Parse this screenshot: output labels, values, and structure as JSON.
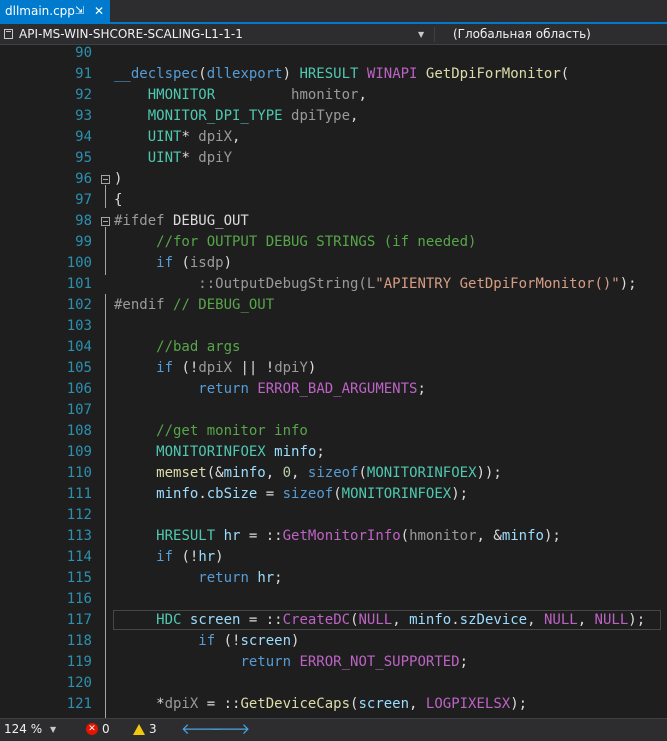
{
  "tab": {
    "title": "dllmain.cpp",
    "pin_icon": "⇲",
    "close_icon": "✕"
  },
  "navbar": {
    "scope_dropdown": "API-MS-WIN-SHCORE-SCALING-L1-1-1",
    "member_dropdown": "(Глобальная область)"
  },
  "editor": {
    "line_numbers": [
      "90",
      "91",
      "92",
      "93",
      "94",
      "95",
      "96",
      "97",
      "98",
      "99",
      "100",
      "101",
      "102",
      "103",
      "104",
      "105",
      "106",
      "107",
      "108",
      "109",
      "110",
      "111",
      "112",
      "113",
      "114",
      "115",
      "116",
      "117",
      "118",
      "119",
      "120",
      "121"
    ],
    "lines": [
      [],
      [
        {
          "t": "__declspec",
          "c": "kw"
        },
        {
          "t": "(",
          "c": ""
        },
        {
          "t": "dllexport",
          "c": "kw"
        },
        {
          "t": ") ",
          "c": ""
        },
        {
          "t": "HRESULT",
          "c": "ty"
        },
        {
          "t": " ",
          "c": ""
        },
        {
          "t": "WINAPI",
          "c": "mac"
        },
        {
          "t": " ",
          "c": ""
        },
        {
          "t": "GetDpiForMonitor",
          "c": "fn"
        },
        {
          "t": "(",
          "c": ""
        }
      ],
      [
        {
          "t": "    ",
          "c": ""
        },
        {
          "t": "HMONITOR",
          "c": "ty"
        },
        {
          "t": "         ",
          "c": ""
        },
        {
          "t": "hmonitor",
          "c": "pa"
        },
        {
          "t": ",",
          "c": ""
        }
      ],
      [
        {
          "t": "    ",
          "c": ""
        },
        {
          "t": "MONITOR_DPI_TYPE",
          "c": "ty"
        },
        {
          "t": " ",
          "c": ""
        },
        {
          "t": "dpiType",
          "c": "pa"
        },
        {
          "t": ",",
          "c": ""
        }
      ],
      [
        {
          "t": "    ",
          "c": ""
        },
        {
          "t": "UINT",
          "c": "ty"
        },
        {
          "t": "* ",
          "c": ""
        },
        {
          "t": "dpiX",
          "c": "pa"
        },
        {
          "t": ",",
          "c": ""
        }
      ],
      [
        {
          "t": "    ",
          "c": ""
        },
        {
          "t": "UINT",
          "c": "ty"
        },
        {
          "t": "* ",
          "c": ""
        },
        {
          "t": "dpiY",
          "c": "pa"
        }
      ],
      [
        {
          "t": ")",
          "c": ""
        }
      ],
      [
        {
          "t": "{",
          "c": ""
        }
      ],
      [
        {
          "t": "#ifdef",
          "c": "pp"
        },
        {
          "t": " DEBUG_OUT",
          "c": ""
        }
      ],
      [
        {
          "t": "     //for OUTPUT DEBUG STRINGS (if needed)",
          "c": "cm"
        }
      ],
      [
        {
          "t": "     ",
          "c": ""
        },
        {
          "t": "if",
          "c": "kw"
        },
        {
          "t": " (",
          "c": ""
        },
        {
          "t": "isdp",
          "c": "pa"
        },
        {
          "t": ")",
          "c": ""
        }
      ],
      [
        {
          "t": "          ::OutputDebugString(L",
          "c": "pa"
        },
        {
          "t": "\"APIENTRY GetDpiForMonitor()\"",
          "c": "st"
        },
        {
          "t": ");",
          "c": ""
        }
      ],
      [
        {
          "t": "#endif",
          "c": "pp"
        },
        {
          "t": " ",
          "c": ""
        },
        {
          "t": "// DEBUG_OUT",
          "c": "cm"
        }
      ],
      [],
      [
        {
          "t": "     //bad args",
          "c": "cm"
        }
      ],
      [
        {
          "t": "     ",
          "c": ""
        },
        {
          "t": "if",
          "c": "kw"
        },
        {
          "t": " (!",
          "c": ""
        },
        {
          "t": "dpiX",
          "c": "pa"
        },
        {
          "t": " || !",
          "c": ""
        },
        {
          "t": "dpiY",
          "c": "pa"
        },
        {
          "t": ")",
          "c": ""
        }
      ],
      [
        {
          "t": "          ",
          "c": ""
        },
        {
          "t": "return",
          "c": "kw"
        },
        {
          "t": " ",
          "c": ""
        },
        {
          "t": "ERROR_BAD_ARGUMENTS",
          "c": "mac"
        },
        {
          "t": ";",
          "c": ""
        }
      ],
      [],
      [
        {
          "t": "     //get monitor info",
          "c": "cm"
        }
      ],
      [
        {
          "t": "     ",
          "c": ""
        },
        {
          "t": "MONITORINFOEX",
          "c": "ty"
        },
        {
          "t": " ",
          "c": ""
        },
        {
          "t": "minfo",
          "c": "va"
        },
        {
          "t": ";",
          "c": ""
        }
      ],
      [
        {
          "t": "     ",
          "c": ""
        },
        {
          "t": "memset",
          "c": "fn"
        },
        {
          "t": "(&",
          "c": ""
        },
        {
          "t": "minfo",
          "c": "va"
        },
        {
          "t": ", ",
          "c": ""
        },
        {
          "t": "0",
          "c": "nm"
        },
        {
          "t": ", ",
          "c": ""
        },
        {
          "t": "sizeof",
          "c": "kw"
        },
        {
          "t": "(",
          "c": ""
        },
        {
          "t": "MONITORINFOEX",
          "c": "ty"
        },
        {
          "t": "));",
          "c": ""
        }
      ],
      [
        {
          "t": "     ",
          "c": ""
        },
        {
          "t": "minfo",
          "c": "va"
        },
        {
          "t": ".",
          "c": ""
        },
        {
          "t": "cbSize",
          "c": "va"
        },
        {
          "t": " = ",
          "c": ""
        },
        {
          "t": "sizeof",
          "c": "kw"
        },
        {
          "t": "(",
          "c": ""
        },
        {
          "t": "MONITORINFOEX",
          "c": "ty"
        },
        {
          "t": ");",
          "c": ""
        }
      ],
      [],
      [
        {
          "t": "     ",
          "c": ""
        },
        {
          "t": "HRESULT",
          "c": "ty"
        },
        {
          "t": " ",
          "c": ""
        },
        {
          "t": "hr",
          "c": "va"
        },
        {
          "t": " = ::",
          "c": ""
        },
        {
          "t": "GetMonitorInfo",
          "c": "mac"
        },
        {
          "t": "(",
          "c": ""
        },
        {
          "t": "hmonitor",
          "c": "pa"
        },
        {
          "t": ", &",
          "c": ""
        },
        {
          "t": "minfo",
          "c": "va"
        },
        {
          "t": ");",
          "c": ""
        }
      ],
      [
        {
          "t": "     ",
          "c": ""
        },
        {
          "t": "if",
          "c": "kw"
        },
        {
          "t": " (!",
          "c": ""
        },
        {
          "t": "hr",
          "c": "va"
        },
        {
          "t": ")",
          "c": ""
        }
      ],
      [
        {
          "t": "          ",
          "c": ""
        },
        {
          "t": "return",
          "c": "kw"
        },
        {
          "t": " ",
          "c": ""
        },
        {
          "t": "hr",
          "c": "va"
        },
        {
          "t": ";",
          "c": ""
        }
      ],
      [],
      [
        {
          "t": "     ",
          "c": ""
        },
        {
          "t": "HDC",
          "c": "ty"
        },
        {
          "t": " ",
          "c": ""
        },
        {
          "t": "screen",
          "c": "va"
        },
        {
          "t": " = ::",
          "c": ""
        },
        {
          "t": "CreateDC",
          "c": "mac"
        },
        {
          "t": "(",
          "c": ""
        },
        {
          "t": "NULL",
          "c": "mac"
        },
        {
          "t": ", ",
          "c": ""
        },
        {
          "t": "minfo",
          "c": "va"
        },
        {
          "t": ".",
          "c": ""
        },
        {
          "t": "szDevice",
          "c": "va"
        },
        {
          "t": ", ",
          "c": ""
        },
        {
          "t": "NULL",
          "c": "mac"
        },
        {
          "t": ", ",
          "c": ""
        },
        {
          "t": "NULL",
          "c": "mac"
        },
        {
          "t": ");",
          "c": ""
        }
      ],
      [
        {
          "t": "          ",
          "c": ""
        },
        {
          "t": "if",
          "c": "kw"
        },
        {
          "t": " (!",
          "c": ""
        },
        {
          "t": "screen",
          "c": "va"
        },
        {
          "t": ")",
          "c": ""
        }
      ],
      [
        {
          "t": "               ",
          "c": ""
        },
        {
          "t": "return",
          "c": "kw"
        },
        {
          "t": " ",
          "c": ""
        },
        {
          "t": "ERROR_NOT_SUPPORTED",
          "c": "mac"
        },
        {
          "t": ";",
          "c": ""
        }
      ],
      [],
      [
        {
          "t": "     *",
          "c": ""
        },
        {
          "t": "dpiX",
          "c": "pa"
        },
        {
          "t": " = ::",
          "c": ""
        },
        {
          "t": "GetDeviceCaps",
          "c": "fn"
        },
        {
          "t": "(",
          "c": ""
        },
        {
          "t": "screen",
          "c": "va"
        },
        {
          "t": ", ",
          "c": ""
        },
        {
          "t": "LOGPIXELSX",
          "c": "mac"
        },
        {
          "t": ");",
          "c": ""
        }
      ]
    ]
  },
  "statusbar": {
    "zoom": "124 %",
    "error_count": "0",
    "warning_count": "3",
    "back_icon": "🡐",
    "forward_icon": "🡒"
  },
  "colors": {
    "accent": "#007acc",
    "keyword": "#569cd6",
    "type": "#4ec9b0",
    "function": "#dcdcaa",
    "macro": "#bd63c5",
    "comment": "#57a64a",
    "string": "#d69d85",
    "line_number": "#2b91af"
  }
}
